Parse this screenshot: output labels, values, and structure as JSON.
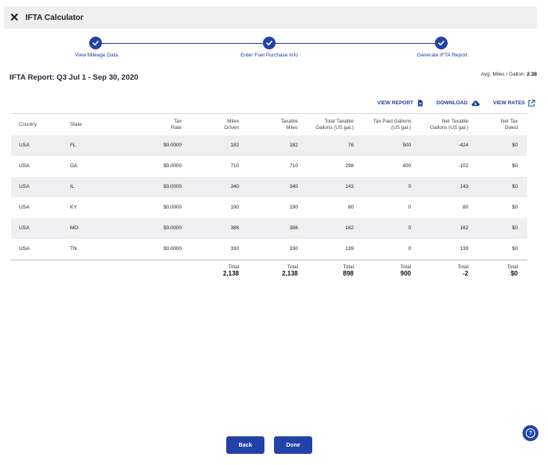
{
  "app": {
    "title": "IFTA Calculator"
  },
  "stepper": {
    "steps": [
      {
        "label": "View Mileage Data"
      },
      {
        "label": "Enter Fuel Purchase Info"
      },
      {
        "label": "Generate IFTA Report"
      }
    ]
  },
  "report": {
    "title": "IFTA Report: Q3 Jul 1 - Sep 30, 2020",
    "avg_label": "Avg. Miles / Gallon:",
    "avg_value": "2.38"
  },
  "actions": {
    "view_report": "VIEW REPORT",
    "download": "DOWNLOAD",
    "view_rates": "VIEW RATES"
  },
  "table": {
    "headers": {
      "country": "Country",
      "state": "State",
      "tax_rate": [
        "Tax",
        "Rate"
      ],
      "miles_driven": [
        "Miles",
        "Driven"
      ],
      "taxable_miles": [
        "Taxable",
        "Miles"
      ],
      "total_taxable_gallons": [
        "Total Taxable",
        "Gallons (US gal.)"
      ],
      "tax_paid_gallons": [
        "Tax Paid Gallons",
        "(US gal.)"
      ],
      "net_taxable_gallons": [
        "Net Taxable",
        "Gallons (US gal.)"
      ],
      "net_tax_owed": [
        "Net Tax",
        "Owed"
      ]
    },
    "rows": [
      [
        "USA",
        "FL",
        "$0.0000",
        "182",
        "182",
        "76",
        "500",
        "-424",
        "$0"
      ],
      [
        "USA",
        "GA",
        "$0.0000",
        "710",
        "710",
        "298",
        "400",
        "-102",
        "$0"
      ],
      [
        "USA",
        "IL",
        "$0.0000",
        "340",
        "340",
        "143",
        "0",
        "143",
        "$0"
      ],
      [
        "USA",
        "KY",
        "$0.0000",
        "190",
        "190",
        "80",
        "0",
        "80",
        "$0"
      ],
      [
        "USA",
        "MO",
        "$0.0000",
        "386",
        "386",
        "162",
        "0",
        "162",
        "$0"
      ],
      [
        "USA",
        "TN",
        "$0.0000",
        "330",
        "330",
        "139",
        "0",
        "139",
        "$0"
      ]
    ],
    "totals": {
      "label": "Total",
      "miles_driven": "2,138",
      "taxable_miles": "2,138",
      "total_taxable_gallons": "898",
      "tax_paid_gallons": "900",
      "net_taxable_gallons": "-2",
      "net_tax_owed": "$0"
    }
  },
  "footer": {
    "back_label": "Back",
    "done_label": "Done",
    "help_glyph": "?"
  },
  "colors": {
    "accent": "#2242a8",
    "link": "#1f3da0",
    "row_shade": "#efeff1",
    "topbar": "#efeff1"
  }
}
